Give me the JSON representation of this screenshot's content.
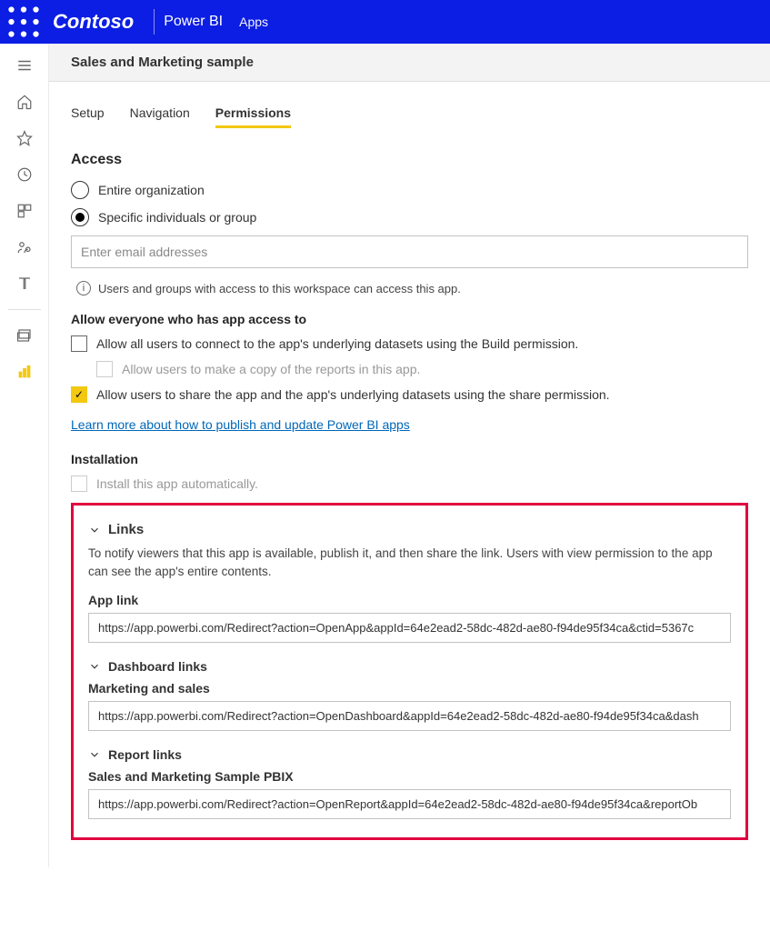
{
  "header": {
    "brand": "Contoso",
    "product": "Power BI",
    "breadcrumb": "Apps"
  },
  "page": {
    "title": "Sales and Marketing sample"
  },
  "tabs": {
    "setup": "Setup",
    "navigation": "Navigation",
    "permissions": "Permissions"
  },
  "access": {
    "heading": "Access",
    "entire_org": "Entire organization",
    "specific": "Specific individuals or group",
    "email_placeholder": "Enter email addresses",
    "info": "Users and groups with access to this workspace can access this app."
  },
  "allow": {
    "heading": "Allow everyone who has app access to",
    "build": "Allow all users to connect to the app's underlying datasets using the Build permission.",
    "copy": "Allow users to make a copy of the reports in this app.",
    "share": "Allow users to share the app and the app's underlying datasets using the share permission.",
    "learn_link": "Learn more about how to publish and update Power BI apps"
  },
  "installation": {
    "heading": "Installation",
    "auto": "Install this app automatically."
  },
  "links": {
    "heading": "Links",
    "desc": "To notify viewers that this app is available, publish it, and then share the link. Users with view permission to the app can see the app's entire contents.",
    "app_link_label": "App link",
    "app_link_value": "https://app.powerbi.com/Redirect?action=OpenApp&appId=64e2ead2-58dc-482d-ae80-f94de95f34ca&ctid=5367c",
    "dashboard_heading": "Dashboard links",
    "dashboard_label": "Marketing and sales",
    "dashboard_value": "https://app.powerbi.com/Redirect?action=OpenDashboard&appId=64e2ead2-58dc-482d-ae80-f94de95f34ca&dash",
    "report_heading": "Report links",
    "report_label": "Sales and Marketing Sample PBIX",
    "report_value": "https://app.powerbi.com/Redirect?action=OpenReport&appId=64e2ead2-58dc-482d-ae80-f94de95f34ca&reportOb"
  }
}
